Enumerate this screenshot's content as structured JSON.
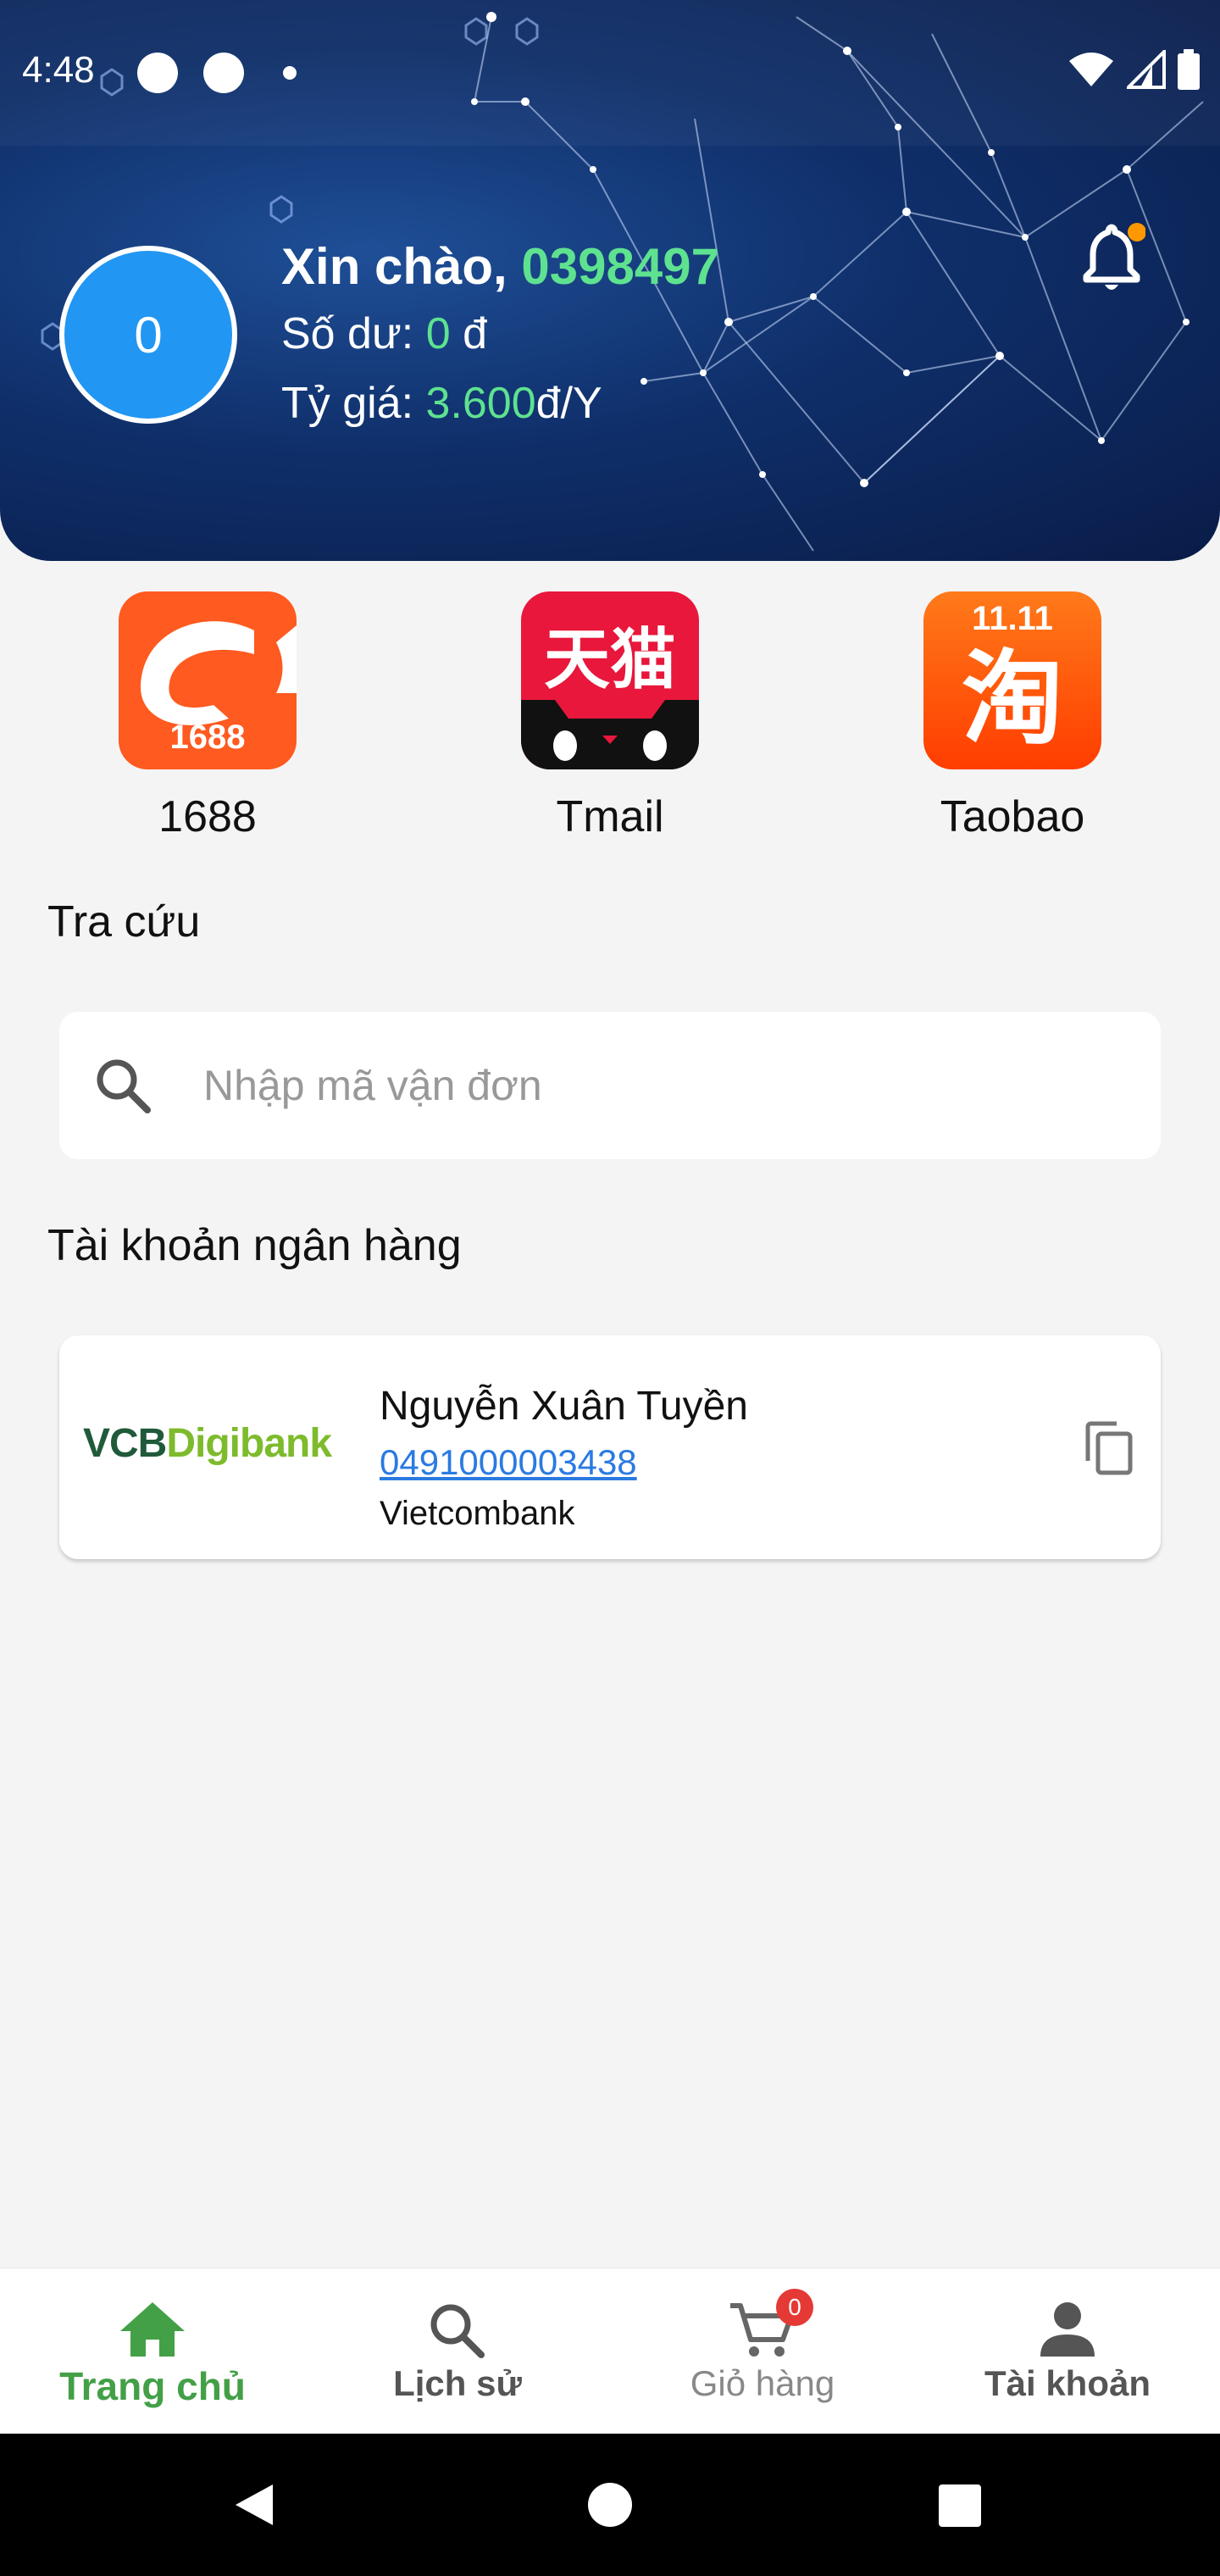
{
  "status_bar": {
    "time": "4:48"
  },
  "header": {
    "avatar_text": "0",
    "greeting_prefix": "Xin chào,",
    "phone": "0398497",
    "balance_label": "Số dư:",
    "balance_value": "0",
    "balance_unit": "đ",
    "rate_label": "Tỷ giá:",
    "rate_value": "3.600",
    "rate_unit": "đ/Y"
  },
  "shops": [
    {
      "label": "1688",
      "icon": "1688-logo",
      "logo_text": "1688",
      "color": "#ff5a1f"
    },
    {
      "label": "Tmail",
      "icon": "tmall-logo",
      "logo_text": "天猫",
      "color": "#e8173b"
    },
    {
      "label": "Taobao",
      "icon": "taobao-logo",
      "logo_text": "淘",
      "badge_text": "11.11",
      "color": "#ff5000"
    }
  ],
  "lookup": {
    "title": "Tra cứu",
    "placeholder": "Nhập mã vận đơn"
  },
  "bank_section": {
    "title": "Tài khoản ngân hàng",
    "account": {
      "logo_vcb": "VCB",
      "logo_digibank": "Digibank",
      "holder": "Nguyễn Xuân Tuyền",
      "number": "0491000003438",
      "bank": "Vietcombank"
    }
  },
  "bottom_nav": [
    {
      "label": "Trang chủ",
      "icon": "home-icon",
      "active": true
    },
    {
      "label": "Lịch sử",
      "icon": "search-icon"
    },
    {
      "label": "Giỏ hàng",
      "icon": "cart-icon",
      "badge": "0"
    },
    {
      "label": "Tài khoản",
      "icon": "person-icon"
    }
  ],
  "colors": {
    "accent_green": "#5ee28f",
    "nav_active": "#43a047",
    "avatar_blue": "#2196f3",
    "link_blue": "#2a7ae2",
    "badge_red": "#e53935"
  }
}
